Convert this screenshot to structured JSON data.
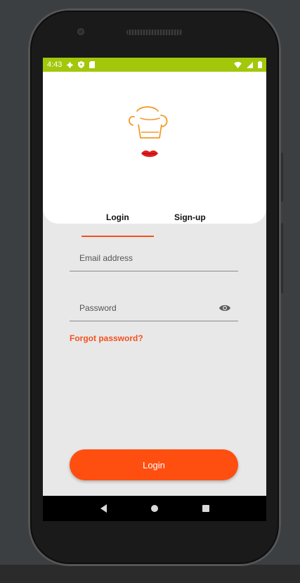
{
  "status_bar": {
    "time": "4:43",
    "left_icons": [
      "gear-icon",
      "shield-icon",
      "sd-card-icon"
    ],
    "right_icons": [
      "wifi-icon",
      "signal-icon",
      "battery-icon"
    ],
    "color": "#a3c70b"
  },
  "logo": {
    "icon": "chef-hat-lips-logo",
    "hat_color": "#f39a2a",
    "lips_color": "#e31e1e"
  },
  "tabs": [
    {
      "label": "Login",
      "selected": true
    },
    {
      "label": "Sign-up",
      "selected": false
    }
  ],
  "form": {
    "email_placeholder": "Email address",
    "password_placeholder": "Password",
    "forgot_password": "Forgot password?"
  },
  "login_button": {
    "label": "Login"
  },
  "colors": {
    "accent": "#f4511e",
    "button": "#ff4f10",
    "screen_bg": "#e8e8e8",
    "card_bg": "#ffffff"
  },
  "nav_bar": {
    "icons": [
      "back-icon",
      "home-icon",
      "recents-icon"
    ]
  }
}
